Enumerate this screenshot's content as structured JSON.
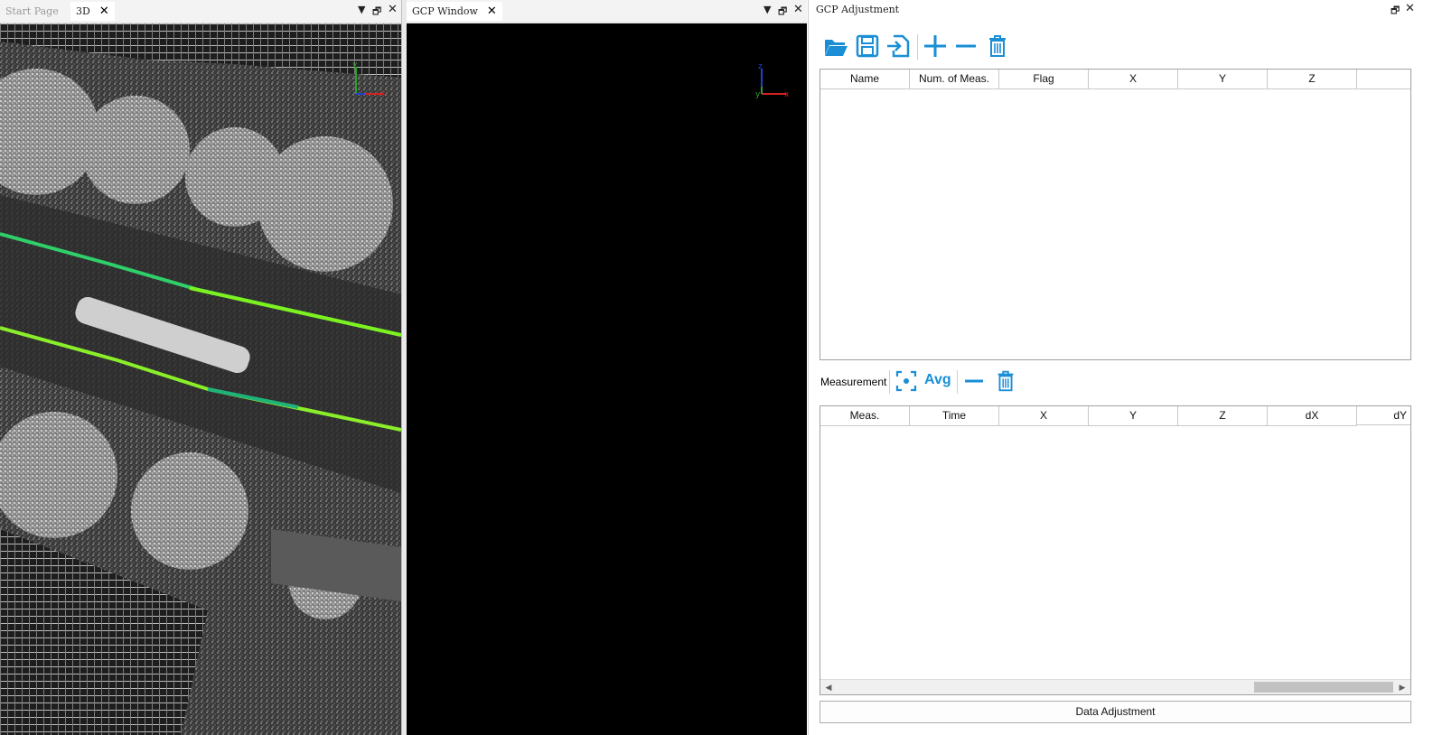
{
  "left_pane": {
    "tabs": [
      {
        "label": "Start Page",
        "active": false
      },
      {
        "label": "3D",
        "active": true
      }
    ],
    "close_glyph": "✕",
    "pin_glyph": "▾",
    "restore_glyph": "🗗",
    "axis": {
      "x": "x",
      "y": "y"
    }
  },
  "middle_pane": {
    "tabs": [
      {
        "label": "GCP Window",
        "active": true
      }
    ],
    "close_glyph": "✕",
    "axis": {
      "x": "x",
      "y": "y",
      "z": "z"
    }
  },
  "right_panel": {
    "title": "GCP Adjustment",
    "accent_color": "#1a8fd6",
    "toolbar_icons": [
      "open-folder-icon",
      "save-icon",
      "import-icon",
      "add-icon",
      "remove-icon",
      "delete-icon"
    ],
    "gcp_table": {
      "columns": [
        "Name",
        "Num. of Meas.",
        "Flag",
        "X",
        "Y",
        "Z"
      ]
    },
    "measurement": {
      "label": "Measurement",
      "avg_label": "Avg",
      "columns": [
        "Meas.",
        "Time",
        "X",
        "Y",
        "Z",
        "dX",
        "dY"
      ]
    },
    "data_adjustment_label": "Data Adjustment"
  }
}
